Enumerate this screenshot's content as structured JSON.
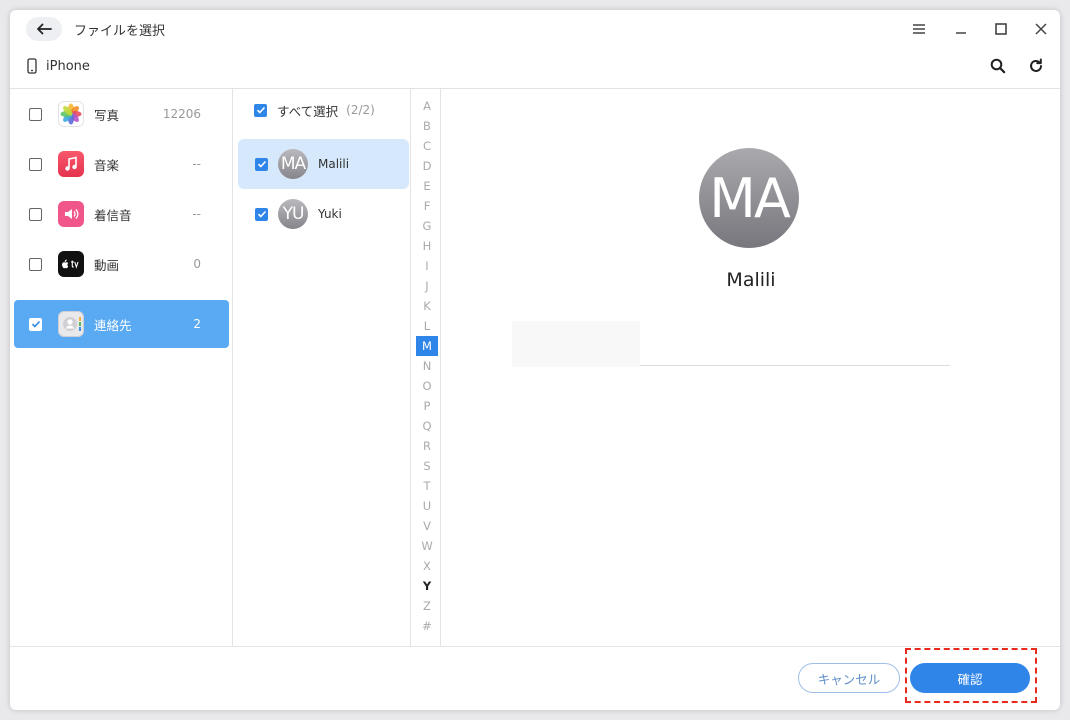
{
  "window": {
    "title": "ファイルを選択"
  },
  "device": {
    "name": "iPhone"
  },
  "categories": [
    {
      "label": "写真",
      "count": "12206",
      "icon": "photos-icon",
      "checked": false,
      "selected": false
    },
    {
      "label": "音楽",
      "count": "--",
      "icon": "music-icon",
      "checked": false,
      "selected": false
    },
    {
      "label": "着信音",
      "count": "--",
      "icon": "ringtone-icon",
      "checked": false,
      "selected": false
    },
    {
      "label": "動画",
      "count": "0",
      "icon": "appletv-icon",
      "checked": false,
      "selected": false
    },
    {
      "label": "連絡先",
      "count": "2",
      "icon": "contacts-icon",
      "checked": true,
      "selected": true
    }
  ],
  "contacts": {
    "select_all_label": "すべて選択",
    "select_all_count": "(2/2)",
    "items": [
      {
        "initials": "MA",
        "name": "Malili",
        "checked": true,
        "selected": true
      },
      {
        "initials": "YU",
        "name": "Yuki",
        "checked": true,
        "selected": false
      }
    ]
  },
  "alphabet": [
    "A",
    "B",
    "C",
    "D",
    "E",
    "F",
    "G",
    "H",
    "I",
    "J",
    "K",
    "L",
    "M",
    "N",
    "O",
    "P",
    "Q",
    "R",
    "S",
    "T",
    "U",
    "V",
    "W",
    "X",
    "Y",
    "Z",
    "#"
  ],
  "alphabet_active": "M",
  "alphabet_bold": "Y",
  "detail": {
    "initials": "MA",
    "name": "Malili"
  },
  "footer": {
    "cancel_label": "キャンセル",
    "confirm_label": "確認"
  },
  "colors": {
    "accent": "#2f86e8",
    "selected_category": "#5aa9f3",
    "selected_contact": "#d6e8fb",
    "highlight": "#e8291c"
  }
}
